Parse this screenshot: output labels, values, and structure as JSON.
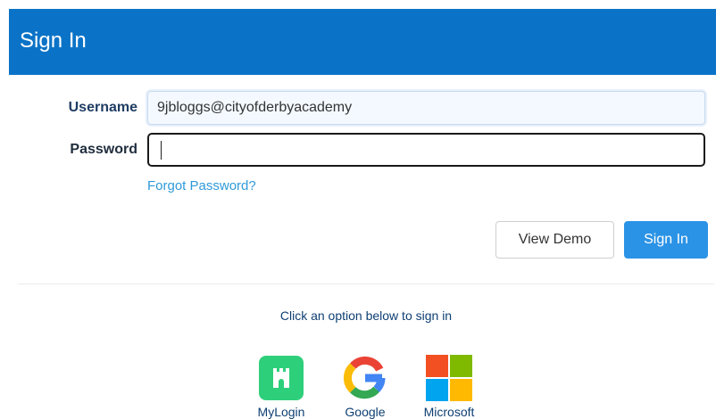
{
  "header": {
    "title": "Sign In",
    "background_color": "#0b73c7"
  },
  "form": {
    "username_label": "Username",
    "username_value": "9jbloggs@cityofderbyacademy",
    "password_label": "Password",
    "password_value": "",
    "forgot_password": "Forgot Password?"
  },
  "buttons": {
    "view_demo": "View Demo",
    "sign_in": "Sign In",
    "sign_in_color": "#2b93e6"
  },
  "sso": {
    "prompt": "Click an option below to sign in",
    "options": [
      {
        "label": "MyLogin",
        "icon": "mylogin-castle-icon",
        "color": "#2ecf7a"
      },
      {
        "label": "Google",
        "icon": "google-icon"
      },
      {
        "label": "Microsoft",
        "icon": "microsoft-icon"
      }
    ]
  }
}
